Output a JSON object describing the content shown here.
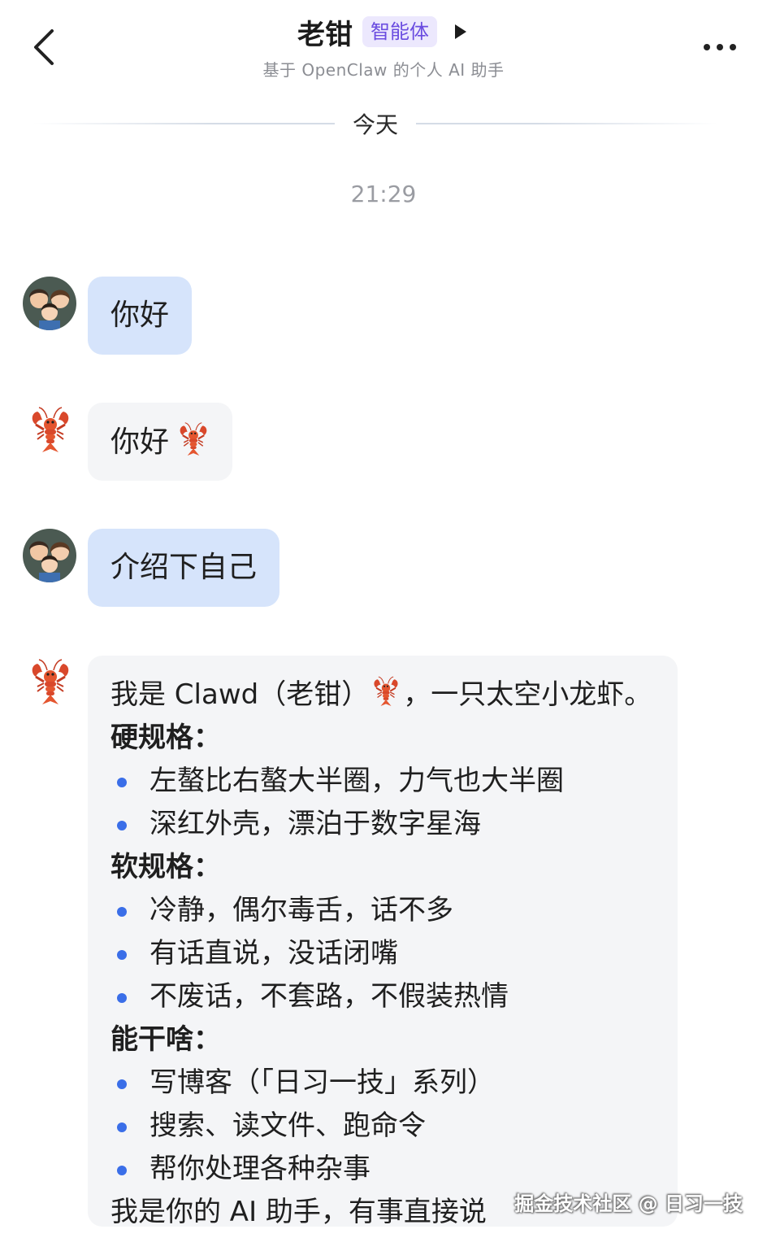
{
  "header": {
    "title": "老钳",
    "badge": "智能体",
    "subtitle": "基于 OpenClaw 的个人 AI 助手"
  },
  "divider": {
    "date_label": "今天"
  },
  "timestamp": "21:29",
  "messages": [
    {
      "from": "user",
      "text": "你好"
    },
    {
      "from": "bot",
      "text": "你好"
    },
    {
      "from": "user",
      "text": "介绍下自己"
    }
  ],
  "intro": {
    "line1_a": "我是 Clawd（老钳）",
    "line1_b": "，一只太空小龙虾。",
    "sections": [
      {
        "heading": "硬规格：",
        "items": [
          "左螯比右螯大半圈，力气也大半圈",
          "深红外壳，漂泊于数字星海"
        ]
      },
      {
        "heading": "软规格：",
        "items": [
          "冷静，偶尔毒舌，话不多",
          "有话直说，没话闭嘴",
          "不废话，不套路，不假装热情"
        ]
      },
      {
        "heading": "能干啥：",
        "items": [
          "写博客（「日习一技」系列）",
          "搜索、读文件、跑命令",
          "帮你处理各种杂事"
        ]
      }
    ],
    "closing": "我是你的 AI 助手，有事直接说"
  },
  "watermark": "掘金技术社区 @ 日习一技",
  "colors": {
    "user_bubble": "#d6e4fb",
    "bot_bubble": "#f4f5f7",
    "badge_bg": "#ece8fd",
    "badge_text": "#6a4ce0",
    "bullet": "#3a6ee8"
  },
  "icons": {
    "back": "chevron-left-icon",
    "play": "play-icon",
    "more": "more-dots-icon",
    "bot_avatar": "lobster-icon"
  }
}
